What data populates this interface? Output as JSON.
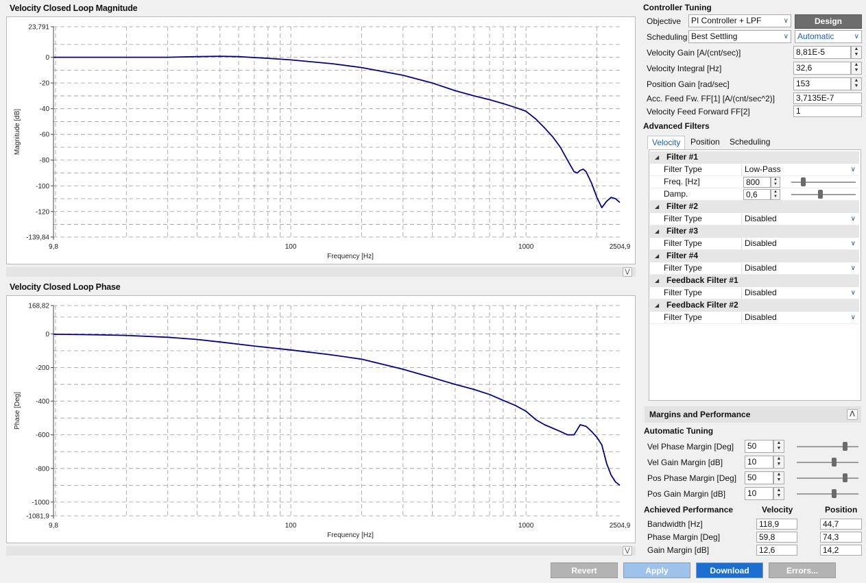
{
  "charts": {
    "magnitude": {
      "title": "Velocity Closed Loop Magnitude",
      "xlabel": "Frequency [Hz]",
      "ylabel": "Magnitude [dB]",
      "x_ticks": [
        "9,8",
        "100",
        "1000",
        "2504,9"
      ],
      "y_ticks": [
        "23,791",
        "0",
        "-20",
        "-40",
        "-60",
        "-80",
        "-100",
        "-120",
        "-139,84"
      ]
    },
    "phase": {
      "title": "Velocity Closed Loop Phase",
      "xlabel": "Frequency [Hz]",
      "ylabel": "Phase [Deg]",
      "x_ticks": [
        "9,8",
        "100",
        "1000",
        "2504,9"
      ],
      "y_ticks": [
        "168,82",
        "0",
        "-200",
        "-400",
        "-600",
        "-800",
        "-1000",
        "-1081,9"
      ]
    }
  },
  "chart_data": [
    {
      "type": "line",
      "title": "Velocity Closed Loop Magnitude",
      "xlabel": "Frequency [Hz]",
      "ylabel": "Magnitude [dB]",
      "x_scale": "log",
      "xlim": [
        9.8,
        2504.9
      ],
      "ylim": [
        -139.84,
        23.791
      ],
      "grid": true,
      "series": [
        {
          "color": "#00008b",
          "x": [
            9.8,
            20,
            30,
            40,
            50,
            60,
            80,
            100,
            150,
            200,
            300,
            400,
            500,
            600,
            700,
            800,
            900,
            1000,
            1100,
            1200,
            1300,
            1400,
            1500,
            1600,
            1650,
            1700,
            1750,
            1800,
            1900,
            2000,
            2100,
            2200,
            2300,
            2400,
            2504.9
          ],
          "y": [
            0,
            0,
            0,
            0.5,
            0.8,
            0.5,
            -0.8,
            -2,
            -5,
            -8,
            -14,
            -20,
            -26,
            -30,
            -33,
            -36,
            -39,
            -42,
            -48,
            -55,
            -62,
            -70,
            -80,
            -89,
            -90,
            -88,
            -87,
            -89,
            -98,
            -109,
            -117,
            -112,
            -109,
            -110,
            -113
          ]
        }
      ]
    },
    {
      "type": "line",
      "title": "Velocity Closed Loop Phase",
      "xlabel": "Frequency [Hz]",
      "ylabel": "Phase [Deg]",
      "x_scale": "log",
      "xlim": [
        9.8,
        2504.9
      ],
      "ylim": [
        -1081.9,
        168.82
      ],
      "grid": true,
      "series": [
        {
          "color": "#00008b",
          "x": [
            9.8,
            15,
            20,
            30,
            40,
            50,
            70,
            100,
            150,
            200,
            300,
            400,
            500,
            600,
            700,
            800,
            900,
            1000,
            1100,
            1200,
            1400,
            1500,
            1600,
            1650,
            1700,
            1800,
            1900,
            2000,
            2100,
            2200,
            2300,
            2400,
            2504.9
          ],
          "y": [
            -2,
            -5,
            -9,
            -20,
            -33,
            -48,
            -72,
            -95,
            -125,
            -150,
            -210,
            -260,
            -300,
            -330,
            -360,
            -395,
            -425,
            -460,
            -510,
            -540,
            -580,
            -600,
            -600,
            -570,
            -540,
            -550,
            -580,
            -615,
            -660,
            -770,
            -840,
            -880,
            -900
          ]
        }
      ]
    }
  ],
  "controller": {
    "title": "Controller Tuning",
    "objective_label": "Objective",
    "objective_value": "PI Controller + LPF",
    "design_button": "Design",
    "scheduling_label": "Scheduling",
    "scheduling_value": "Best Settling",
    "scheduling_mode": "Automatic",
    "params": [
      {
        "label": "Velocity Gain [A/(cnt/sec)]",
        "value": "8,81E-5"
      },
      {
        "label": "Velocity Integral [Hz]",
        "value": "32,6"
      },
      {
        "label": "Position Gain [rad/sec]",
        "value": "153"
      },
      {
        "label": "Acc. Feed Fw. FF[1] [A/(cnt/sec^2)]",
        "value": "3,7135E-7"
      },
      {
        "label": "Velocity Feed Forward FF[2]",
        "value": "1"
      }
    ]
  },
  "filters": {
    "title": "Advanced Filters",
    "tabs": [
      "Velocity",
      "Position",
      "Scheduling"
    ],
    "filter1": {
      "name": "Filter #1",
      "type_label": "Filter Type",
      "type_value": "Low-Pass",
      "freq_label": "Freq. [Hz]",
      "freq_value": "800",
      "damp_label": "Damp.",
      "damp_value": "0,6",
      "freq_level": 0.18,
      "damp_level": 0.45
    },
    "groups": [
      {
        "name": "Filter #2",
        "type_label": "Filter Type",
        "type_value": "Disabled"
      },
      {
        "name": "Filter #3",
        "type_label": "Filter Type",
        "type_value": "Disabled"
      },
      {
        "name": "Filter #4",
        "type_label": "Filter Type",
        "type_value": "Disabled"
      },
      {
        "name": "Feedback Filter #1",
        "type_label": "Filter Type",
        "type_value": "Disabled"
      },
      {
        "name": "Feedback Filter #2",
        "type_label": "Filter Type",
        "type_value": "Disabled"
      }
    ]
  },
  "margins": {
    "title": "Margins and Performance",
    "auto_title": "Automatic Tuning",
    "auto": [
      {
        "label": "Vel Phase Margin [Deg]",
        "value": "50",
        "level": 0.78
      },
      {
        "label": "Vel Gain Margin [dB]",
        "value": "10",
        "level": 0.6
      },
      {
        "label": "Pos Phase Margin [Deg]",
        "value": "50",
        "level": 0.78
      },
      {
        "label": "Pos Gain Margin [dB]",
        "value": "10",
        "level": 0.6
      }
    ],
    "achieved_title": "Achieved Performance",
    "col_velocity": "Velocity",
    "col_position": "Position",
    "achieved": [
      {
        "label": "Bandwidth [Hz]",
        "velocity": "118,9",
        "position": "44,7"
      },
      {
        "label": "Phase Margin [Deg]",
        "velocity": "59,8",
        "position": "74,3"
      },
      {
        "label": "Gain Margin [dB]",
        "velocity": "12,6",
        "position": "14,2"
      }
    ]
  },
  "buttons": {
    "revert": "Revert",
    "apply": "Apply",
    "download": "Download",
    "errors": "Errors..."
  },
  "colors": {
    "curve": "#00008b",
    "download_button": "#1a6fd0",
    "disabled_button": "#b3b3b3",
    "apply_button": "#9ec3ea",
    "accent_text": "#1e5fb3"
  }
}
